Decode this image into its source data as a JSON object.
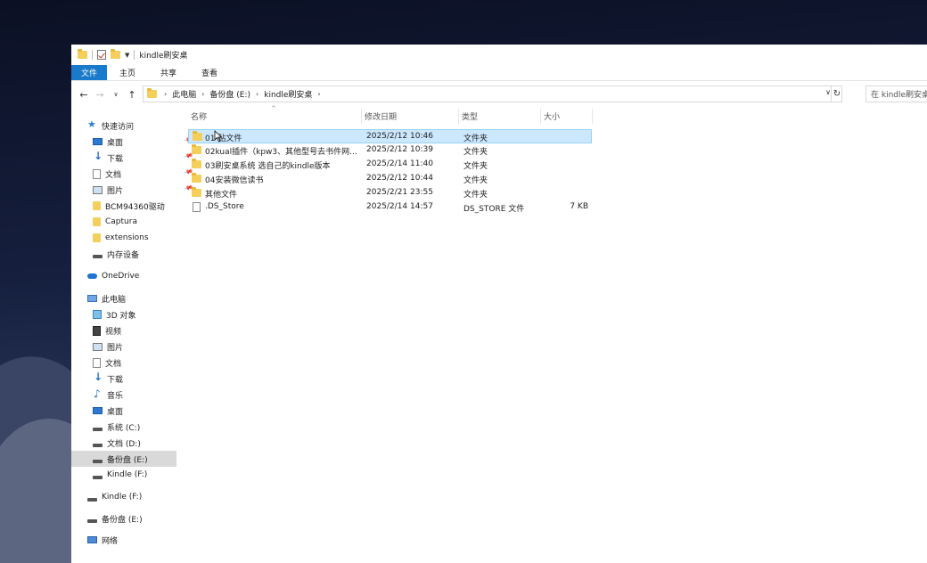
{
  "window": {
    "title": "kindle刷安桌"
  },
  "ribbon": {
    "tabs": [
      "文件",
      "主页",
      "共享",
      "查看"
    ]
  },
  "address": {
    "crumbs": [
      "此电脑",
      "备份盘 (E:)",
      "kindle刷安桌"
    ],
    "search_placeholder": "在 kindle刷安桌"
  },
  "nav": {
    "quick_access": "快速访问",
    "items": [
      {
        "label": "桌面",
        "icon": "desktop-icon",
        "pinned": true
      },
      {
        "label": "下载",
        "icon": "download-icon",
        "pinned": true
      },
      {
        "label": "文档",
        "icon": "document-icon",
        "pinned": true
      },
      {
        "label": "图片",
        "icon": "pictures-icon",
        "pinned": true
      },
      {
        "label": "BCM94360驱动",
        "icon": "folder-icon"
      },
      {
        "label": "Captura",
        "icon": "folder-icon"
      },
      {
        "label": "extensions",
        "icon": "folder-icon"
      },
      {
        "label": "内存设备",
        "icon": "drive-icon"
      }
    ],
    "onedrive": "OneDrive",
    "this_pc": "此电脑",
    "pc_items": [
      {
        "label": "3D 对象",
        "icon": "3d-objects-icon"
      },
      {
        "label": "视频",
        "icon": "video-icon"
      },
      {
        "label": "图片",
        "icon": "pictures-icon"
      },
      {
        "label": "文档",
        "icon": "document-icon"
      },
      {
        "label": "下载",
        "icon": "download-icon"
      },
      {
        "label": "音乐",
        "icon": "music-icon"
      },
      {
        "label": "桌面",
        "icon": "desktop-icon"
      },
      {
        "label": "系统 (C:)",
        "icon": "drive-icon"
      },
      {
        "label": "文档 (D:)",
        "icon": "drive-icon"
      },
      {
        "label": "备份盘 (E:)",
        "icon": "drive-icon"
      },
      {
        "label": "Kindle (F:)",
        "icon": "drive-icon"
      }
    ],
    "kindle": "Kindle (F:)",
    "backup": "备份盘 (E:)",
    "network": "网络"
  },
  "columns": [
    "名称",
    "修改日期",
    "类型",
    "大小"
  ],
  "files": [
    {
      "name": "01 贴文件",
      "date": "2025/2/12 10:46",
      "type": "文件夹",
      "size": "",
      "kind": "folder",
      "selected": true
    },
    {
      "name": "02kual插件（kpw3、其他型号去书件网...",
      "date": "2025/2/12 10:39",
      "type": "文件夹",
      "size": "",
      "kind": "folder"
    },
    {
      "name": "03刷安桌系统 选自己的kindle版本",
      "date": "2025/2/14 11:40",
      "type": "文件夹",
      "size": "",
      "kind": "folder"
    },
    {
      "name": "04安装微信读书",
      "date": "2025/2/12 10:44",
      "type": "文件夹",
      "size": "",
      "kind": "folder"
    },
    {
      "name": "其他文件",
      "date": "2025/2/21 23:55",
      "type": "文件夹",
      "size": "",
      "kind": "folder"
    },
    {
      "name": ".DS_Store",
      "date": "2025/2/14 14:57",
      "type": "DS_STORE 文件",
      "size": "7 KB",
      "kind": "file"
    }
  ]
}
